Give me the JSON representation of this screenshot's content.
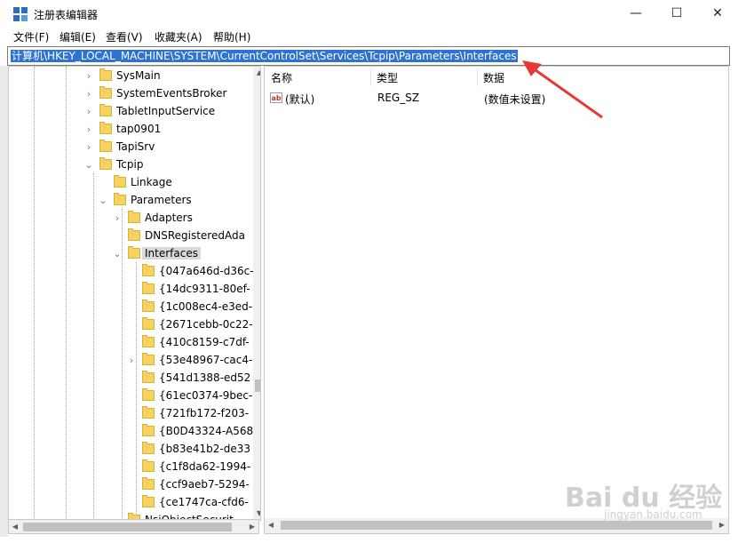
{
  "window": {
    "title": "注册表编辑器",
    "minimize": "—",
    "maximize": "☐",
    "close": "✕"
  },
  "menu": [
    "文件(F)",
    "编辑(E)",
    "查看(V)",
    "收藏夹(A)",
    "帮助(H)"
  ],
  "address": "计算机\\HKEY_LOCAL_MACHINE\\SYSTEM\\CurrentControlSet\\Services\\Tcpip\\Parameters\\Interfaces",
  "tree": {
    "items": [
      {
        "label": "SysMain",
        "expander": "›"
      },
      {
        "label": "SystemEventsBroker",
        "expander": "›"
      },
      {
        "label": "TabletInputService",
        "expander": "›"
      },
      {
        "label": "tap0901",
        "expander": "›"
      },
      {
        "label": "TapiSrv",
        "expander": "›"
      },
      {
        "label": "Tcpip",
        "expander": "⌄"
      },
      {
        "label": "Linkage",
        "expander": ""
      },
      {
        "label": "Parameters",
        "expander": "⌄"
      },
      {
        "label": "Adapters",
        "expander": "›"
      },
      {
        "label": "DNSRegisteredAda",
        "expander": ""
      },
      {
        "label": "Interfaces",
        "expander": "⌄",
        "selected": true
      },
      {
        "label": "{047a646d-d36c-",
        "expander": ""
      },
      {
        "label": "{14dc9311-80ef-",
        "expander": ""
      },
      {
        "label": "{1c008ec4-e3ed-",
        "expander": ""
      },
      {
        "label": "{2671cebb-0c22-",
        "expander": ""
      },
      {
        "label": "{410c8159-c7df-",
        "expander": ""
      },
      {
        "label": "{53e48967-cac4-",
        "expander": "›"
      },
      {
        "label": "{541d1388-ed52",
        "expander": ""
      },
      {
        "label": "{61ec0374-9bec-",
        "expander": ""
      },
      {
        "label": "{721fb172-f203-",
        "expander": ""
      },
      {
        "label": "{B0D43324-A568",
        "expander": ""
      },
      {
        "label": "{b83e41b2-de33",
        "expander": ""
      },
      {
        "label": "{c1f8da62-1994-",
        "expander": ""
      },
      {
        "label": "{ccf9aeb7-5294-",
        "expander": ""
      },
      {
        "label": "{ce1747ca-cfd6-",
        "expander": ""
      },
      {
        "label": "NsiObjectSecurit",
        "expander": ""
      }
    ]
  },
  "list": {
    "columns": [
      "名称",
      "类型",
      "数据"
    ],
    "rows": [
      {
        "name": "(默认)",
        "type": "REG_SZ",
        "data": "(数值未设置)"
      }
    ],
    "icon": "ab"
  },
  "watermark": {
    "main": "Bai du 经验",
    "sub": "jingyan.baidu.com"
  },
  "colors": {
    "selection": "#3072d2",
    "annotation_arrow": "#e53935",
    "folder": "#f6d35e"
  },
  "icons": {
    "app": "registry-editor-icon",
    "folder": "folder-icon",
    "value": "string-value-icon"
  }
}
